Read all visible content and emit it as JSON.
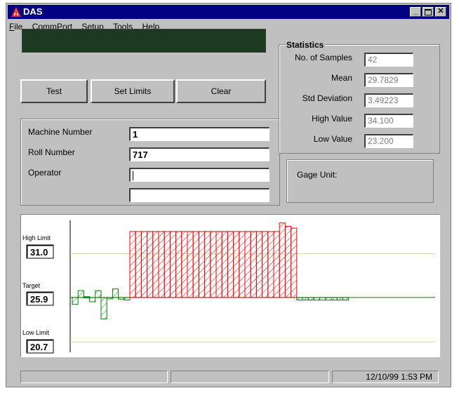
{
  "window": {
    "title": "DAS"
  },
  "menu": [
    {
      "label": "File",
      "mnemonic": "F",
      "rest": "ile"
    },
    {
      "label": "CommPort",
      "mnemonic": "C",
      "rest": "ommPort"
    },
    {
      "label": "Setup",
      "mnemonic": "S",
      "rest": "etup"
    },
    {
      "label": "Tools",
      "mnemonic": "",
      "rest": "Tools"
    },
    {
      "label": "Help",
      "mnemonic": "",
      "rest": "Help"
    }
  ],
  "buttons": {
    "test": "Test",
    "set_limits": "Set Limits",
    "clear": "Clear"
  },
  "fields": {
    "machine_number": {
      "label": "Machine Number",
      "value": "1"
    },
    "roll_number": {
      "label": "Roll Number",
      "value": "717"
    },
    "operator": {
      "label": "Operator",
      "value": ""
    },
    "extra": {
      "value": ""
    }
  },
  "statistics": {
    "title": "Statistics",
    "samples": {
      "label": "No. of Samples",
      "value": "42"
    },
    "mean": {
      "label": "Mean",
      "value": "29.7829"
    },
    "std": {
      "label": "Std Deviation",
      "value": "3.49223"
    },
    "high": {
      "label": "High Value",
      "value": "34.100"
    },
    "low": {
      "label": "Low Value",
      "value": "23.200"
    }
  },
  "gage": {
    "label": "Gage Unit:"
  },
  "chart_data": {
    "type": "bar",
    "high_limit_label": "High Limit",
    "high_limit": 31.0,
    "high_limit_text": "31.0",
    "target_label": "Target",
    "target": 25.9,
    "target_text": "25.9",
    "low_limit_label": "Low Limit",
    "low_limit": 20.7,
    "low_limit_text": "20.7",
    "ylim": [
      19.5,
      34.9
    ],
    "values": [
      25.1,
      26.7,
      26.0,
      25.4,
      26.7,
      23.4,
      25.9,
      26.9,
      25.7,
      25.6,
      33.6,
      33.6,
      33.6,
      33.6,
      33.6,
      33.6,
      33.6,
      33.6,
      33.6,
      33.6,
      33.6,
      33.6,
      33.6,
      33.6,
      33.6,
      33.6,
      33.6,
      33.6,
      33.6,
      33.6,
      33.6,
      33.6,
      33.6,
      33.6,
      33.6,
      33.6,
      34.6,
      34.2,
      34.0,
      25.6,
      25.6,
      25.6,
      25.6,
      25.6,
      25.6,
      25.6,
      25.6,
      25.6
    ],
    "colors": {
      "over": "#ff0000",
      "normal": "#008000",
      "limit_line": "#e8e800",
      "target_line": "#008000"
    }
  },
  "status": {
    "datetime": "12/10/99 1:53 PM"
  }
}
